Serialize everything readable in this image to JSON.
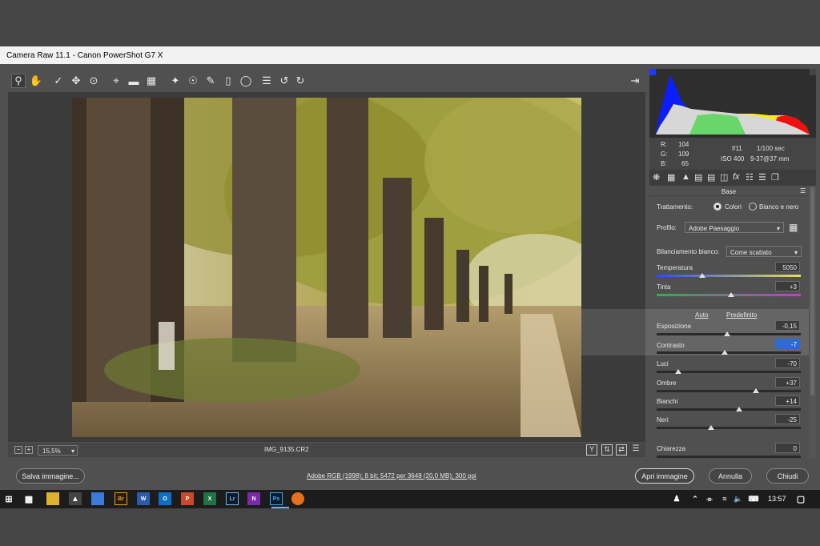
{
  "window": {
    "title": "Camera Raw 11.1  -  Canon PowerShot G7 X"
  },
  "toolbar": {
    "tools": [
      "zoom-tool",
      "hand-tool",
      "white-balance-tool",
      "color-sampler-tool",
      "targeted-adjustment-tool",
      "crop-tool",
      "straighten-tool",
      "transform-tool",
      "spot-removal-tool",
      "red-eye-tool",
      "adjustment-brush-tool",
      "graduated-filter-tool",
      "radial-filter-tool",
      "preferences-tool",
      "rotate-left-tool",
      "rotate-right-tool",
      "fullscreen-toggle"
    ]
  },
  "viewer": {
    "zoom": "15,5%",
    "filename": "IMG_9135.CR2"
  },
  "histogram": {
    "r": "104",
    "g": "109",
    "b": "65",
    "r_label": "R:",
    "g_label": "G:",
    "b_label": "B:",
    "aperture": "f/11",
    "shutter": "1/100 sec",
    "iso": "ISO 400",
    "lens": "9-37@37 mm"
  },
  "panel": {
    "title": "Base",
    "treatment_label": "Trattamento:",
    "treatment_color": "Colori",
    "treatment_bw": "Bianco e nero",
    "profile_label": "Profilo:",
    "profile_value": "Adobe Paesaggio",
    "wb_label": "Bilanciamento bianco:",
    "wb_value": "Come scattato",
    "temp_label": "Temperatura",
    "temp_value": "5050",
    "tint_label": "Tinta",
    "tint_value": "+3",
    "auto": "Auto",
    "default": "Predefinito",
    "exposure_label": "Esposizione",
    "exposure_value": "-0,15",
    "contrast_label": "Contrasto",
    "contrast_value": "-7",
    "highlights_label": "Luci",
    "highlights_value": "-70",
    "shadows_label": "Ombre",
    "shadows_value": "+37",
    "whites_label": "Bianchi",
    "whites_value": "+14",
    "blacks_label": "Neri",
    "blacks_value": "-25",
    "clarity_label": "Chiarezza",
    "clarity_value": "0"
  },
  "footer": {
    "save": "Salva immagine...",
    "workflow": "Adobe RGB (1998); 8 bit; 5472 per 3648 (20,0 MB); 300 ppi",
    "open": "Apri immagine",
    "cancel": "Annulla",
    "done": "Chiudi"
  },
  "taskbar": {
    "time": "13:57",
    "apps": [
      "Br",
      "W",
      "O",
      "P",
      "X",
      "Lr",
      "N",
      "Ps"
    ]
  }
}
